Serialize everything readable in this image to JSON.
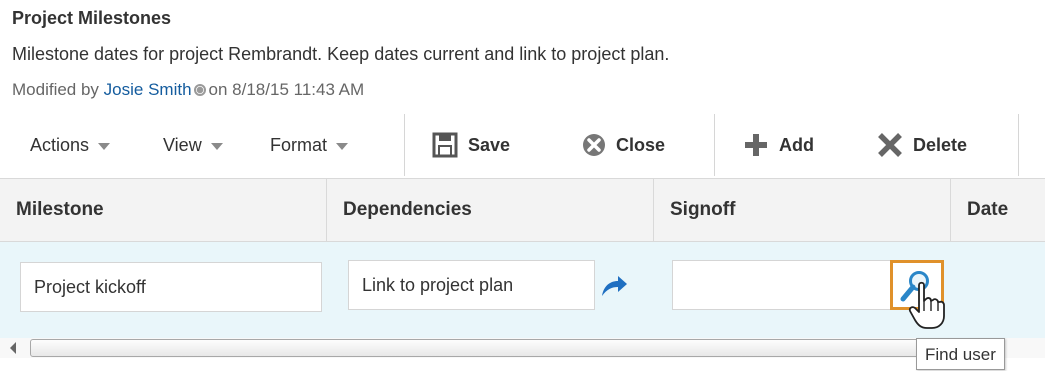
{
  "header": {
    "title": "Project Milestones",
    "description": "Milestone dates for project Rembrandt. Keep dates current and link to project plan.",
    "modified_prefix": "Modified by",
    "modified_user": "Josie Smith",
    "modified_suffix": "on 8/18/15 11:43 AM"
  },
  "toolbar": {
    "menus": [
      "Actions",
      "View",
      "Format"
    ],
    "save_label": "Save",
    "close_label": "Close",
    "add_label": "Add",
    "delete_label": "Delete"
  },
  "table": {
    "columns": [
      "Milestone",
      "Dependencies",
      "Signoff",
      "Date"
    ],
    "rows": [
      {
        "milestone": "Project kickoff",
        "dependencies": "Link to project plan",
        "signoff": "",
        "date": ""
      }
    ]
  },
  "tooltip": {
    "text": "Find user"
  },
  "colors": {
    "accent": "#e0912a",
    "link": "#145c9e",
    "row_selected": "#e9f6fa",
    "header_bg": "#f3f3f3"
  },
  "icons": [
    "save-icon",
    "close-icon",
    "add-icon",
    "delete-icon",
    "link-arrow-icon",
    "search-user-icon",
    "hand-cursor-icon",
    "presence-icon"
  ]
}
